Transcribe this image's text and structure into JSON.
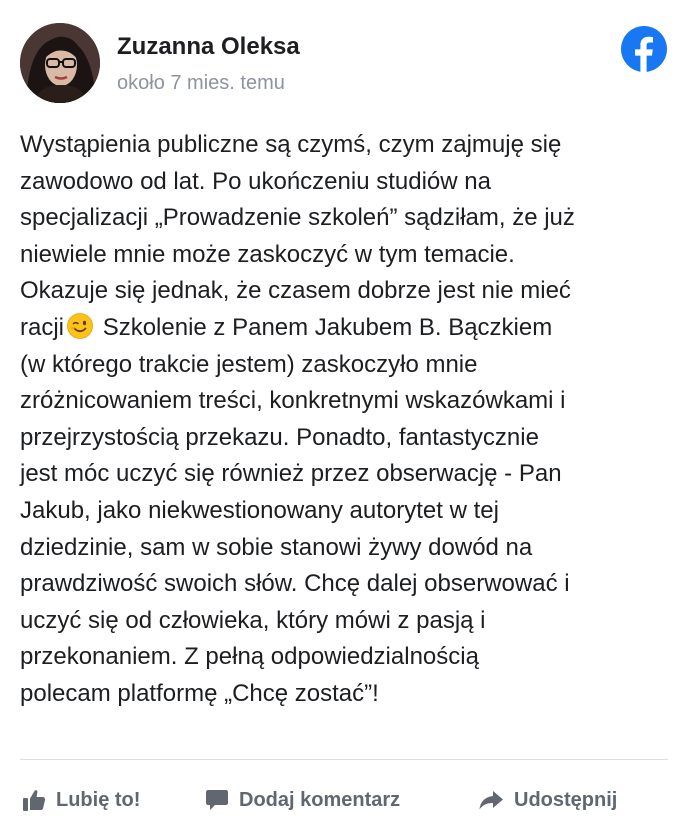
{
  "post": {
    "author": "Zuzanna Oleksa",
    "timestamp": "około 7 mies. temu",
    "body_lines": [
      "Wystąpienia publiczne są czymś, czym zajmuję się",
      "zawodowo od lat. Po ukończeniu studiów na",
      "specjalizacji „Prowadzenie szkoleń” sądziłam, że już",
      "niewiele mnie może zaskoczyć w tym temacie.",
      "Okazuje się jednak, że czasem dobrze jest nie mieć",
      "racji",
      "Szkolenie z Panem Jakubem B. Bączkiem",
      "(w którego trakcie jestem) zaskoczyło mnie",
      "zróżnicowaniem treści, konkretnymi wskazówkami i",
      "przejrzystością przekazu. Ponadto, fantastycznie",
      "jest móc uczyć się również przez obserwację - Pan",
      "Jakub, jako niekwestionowany autorytet w tej",
      "dziedzinie, sam w sobie stanowi żywy dowód na",
      "prawdziwość swoich słów. Chcę dalej obserwować i",
      "uczyć się od człowieka, który mówi z pasją i",
      "przekonaniem. Z pełną odpowiedzialnością",
      "polecam platformę „Chcę zostać”!"
    ]
  },
  "actions": {
    "like_label": "Lubię to!",
    "comment_label": "Dodaj komentarz",
    "share_label": "Udostępnij"
  },
  "icons": {
    "brand": "facebook-logo-icon",
    "emoji": "winking-face-emoji-icon",
    "like": "thumbs-up-icon",
    "comment": "comment-bubble-icon",
    "share": "share-arrow-icon"
  },
  "colors": {
    "facebook_blue": "#1877f2",
    "text": "#1c1e21",
    "muted": "#8d949e",
    "action": "#606770"
  }
}
